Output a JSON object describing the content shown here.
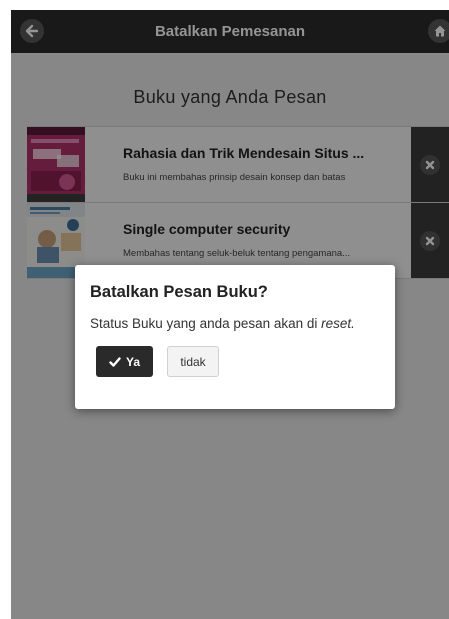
{
  "header": {
    "title": "Batalkan Pemesanan",
    "back_icon": "back-arrow-icon",
    "home_icon": "home-icon"
  },
  "main": {
    "section_title": "Buku yang Anda Pesan",
    "books": [
      {
        "title": "Rahasia dan Trik Mendesain Situs ...",
        "description": "Buku ini membahas prinsip desain konsep dan batas",
        "delete_icon": "delete-x-icon"
      },
      {
        "title": "Single computer security",
        "description": "Membahas tentang seluk-beluk tentang pengamana...",
        "delete_icon": "delete-x-icon"
      }
    ]
  },
  "dialog": {
    "title": "Batalkan Pesan Buku?",
    "message_prefix": "Status Buku yang anda pesan akan di ",
    "message_emphasis": "reset.",
    "confirm_label": "Ya",
    "confirm_icon": "check-icon",
    "cancel_label": "tidak"
  },
  "colors": {
    "header_bg": "#2b2b2b",
    "page_bg": "#e9e9e9",
    "confirm_bg": "#2a2a2a",
    "delete_bg": "#3b3b3b"
  }
}
